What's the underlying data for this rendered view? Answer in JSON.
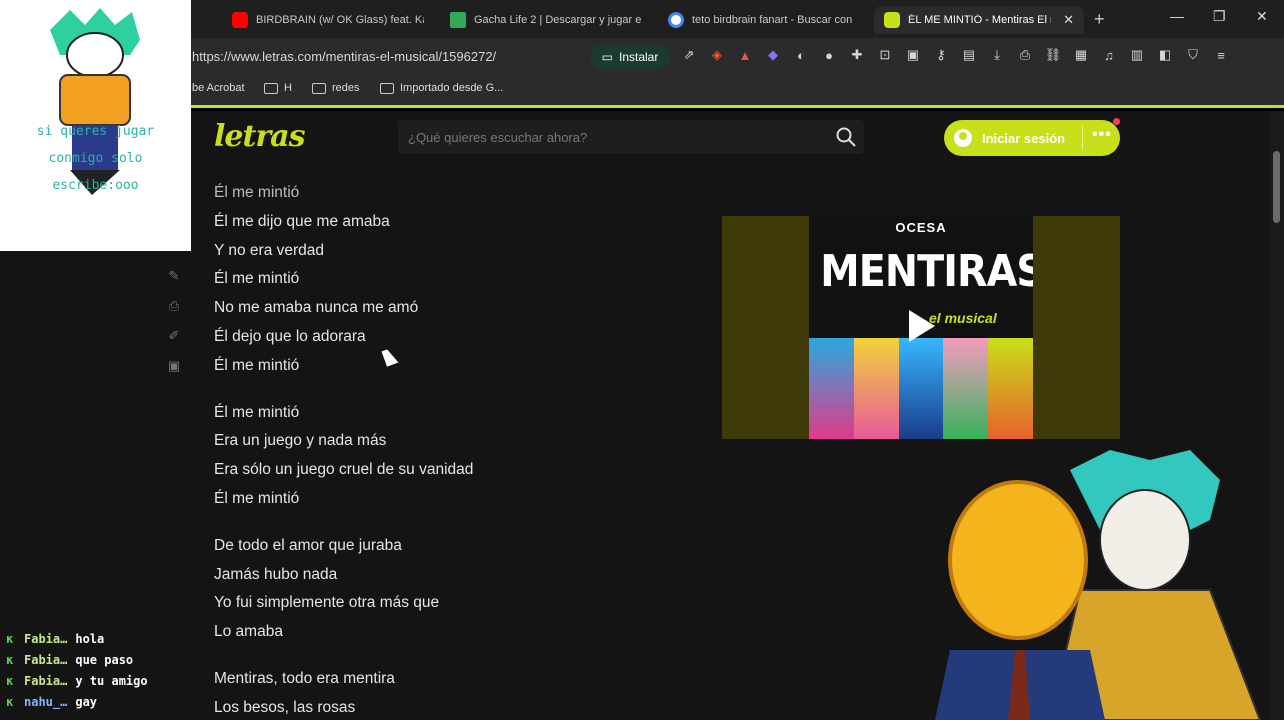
{
  "tabs": [
    {
      "title": "BIRDBRAIN (w/ OK Glass) feat. Kas",
      "favicon": "youtube-icon",
      "color": "#ff0000"
    },
    {
      "title": "Gacha Life 2 | Descargar y jugar en",
      "favicon": "play-store-icon",
      "color": "#34a853"
    },
    {
      "title": "teto birdbrain fanart - Buscar con",
      "favicon": "google-icon",
      "color": "#4285f4"
    },
    {
      "title": "ÉL ME MINTIÓ - Mentiras El m",
      "favicon": "letras-icon",
      "color": "#c7e01a",
      "active": true
    }
  ],
  "address": {
    "url": "https://www.letras.com/mentiras-el-musical/1596272/",
    "install_label": "Instalar"
  },
  "bookmarks": [
    {
      "label": "be Acrobat"
    },
    {
      "label": "H"
    },
    {
      "label": "redes"
    },
    {
      "label": "Importado desde G..."
    }
  ],
  "site": {
    "logo": "letras",
    "search_placeholder": "¿Qué quieres escuchar ahora?",
    "login_label": "Iniciar sesión",
    "accent": "#c7e01a"
  },
  "lyrics": [
    [
      "Él me mintió",
      "Él me dijo que me amaba",
      "Y no era verdad",
      "Él me mintió",
      "No me amaba nunca me amó",
      "Él dejo que lo adorara",
      "Él me mintió"
    ],
    [
      "Él me mintió",
      "Era un juego y nada más",
      "Era sólo un juego cruel de su vanidad",
      "Él me mintió"
    ],
    [
      "De todo el amor que juraba",
      "Jamás hubo nada",
      "Yo fui simplemente otra más que",
      "Lo amaba"
    ],
    [
      "Mentiras, todo era mentira",
      "Los besos, las rosas"
    ]
  ],
  "video": {
    "brand": "OCESA",
    "title": "MENTIRAS",
    "subtitle": "el musical"
  },
  "overlay": {
    "text_lines": [
      "si queres jugar",
      "conmigo solo",
      "escribe:ooo"
    ]
  },
  "chat": [
    {
      "user": "Fabia…",
      "message": "hola"
    },
    {
      "user": "Fabia…",
      "message": "que paso"
    },
    {
      "user": "Fabia…",
      "message": "y tu amigo"
    },
    {
      "user": "nahu_…",
      "message": "gay"
    }
  ]
}
